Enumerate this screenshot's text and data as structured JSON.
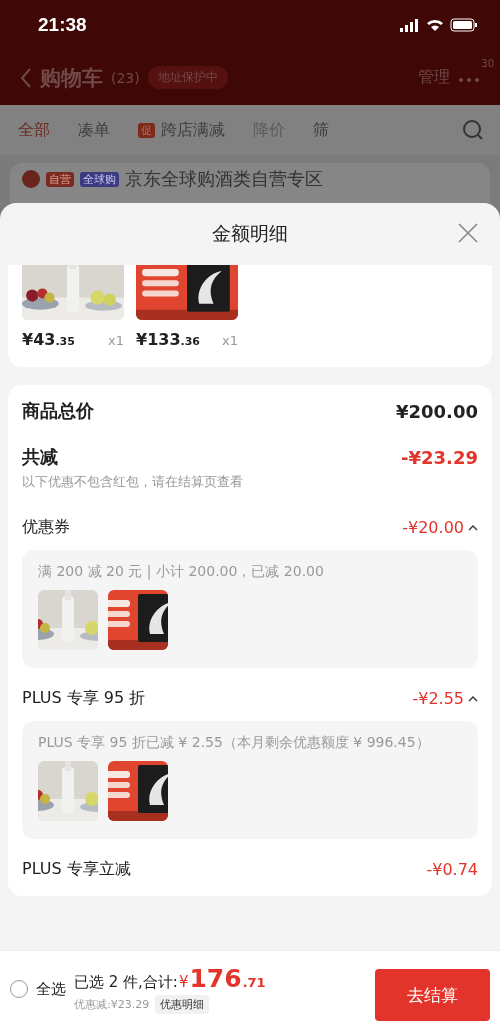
{
  "status_bar": {
    "time": "21:38"
  },
  "header": {
    "title": "购物车",
    "count": "(23)",
    "address_badge": "地址保护中",
    "manage": "管理",
    "more_badge": "30"
  },
  "tabs": [
    {
      "label": "全部",
      "selected": true
    },
    {
      "label": "凑单",
      "selected": false
    },
    {
      "label": "跨店满减",
      "selected": false,
      "tag": "促"
    },
    {
      "label": "降价",
      "selected": false
    },
    {
      "label": "筛",
      "selected": false
    }
  ],
  "store": {
    "checked": true,
    "tags": [
      "自营",
      "全球购"
    ],
    "name": "京东全球购酒类自营专区"
  },
  "sheet": {
    "title": "金额明细",
    "products": [
      {
        "price": "¥43",
        "decimal": ".35",
        "qty": "x1"
      },
      {
        "price": "¥133",
        "decimal": ".36",
        "qty": "x1"
      }
    ],
    "total": {
      "label": "商品总价",
      "value": "¥200.00"
    },
    "reduction": {
      "label": "共减",
      "value": "-¥23.29",
      "note": "以下优惠不包含红包，请在结算页查看"
    },
    "discounts": [
      {
        "kind": "expandable",
        "label": "优惠券",
        "amount": "-¥20.00",
        "expanded": true,
        "detail": "满 200 减 20 元 | 小计 200.00，已减 20.00"
      },
      {
        "kind": "expandable",
        "label": "PLUS 专享 95 折",
        "amount": "-¥2.55",
        "expanded": true,
        "detail": "PLUS 专享 95 折已减 ¥ 2.55（本月剩余优惠额度 ¥ 996.45）"
      },
      {
        "kind": "plain",
        "label": "PLUS 专享立减",
        "amount": "-¥0.74"
      }
    ]
  },
  "bottom_bar": {
    "select_all": {
      "checked": false,
      "label": "全选"
    },
    "summary": "已选 2 件,合计:",
    "currency": "¥",
    "price": "176",
    "decimal": ".71",
    "savings": "优惠减:¥23.29",
    "detail_button": "优惠明细",
    "checkout": "去结算"
  }
}
